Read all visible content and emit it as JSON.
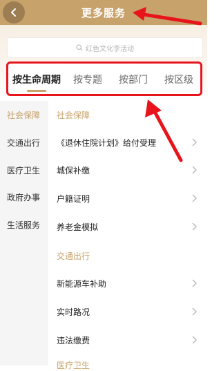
{
  "header": {
    "title": "更多服务"
  },
  "search": {
    "placeholder": "红色文化李活动"
  },
  "tabs": [
    {
      "label": "按生命周期"
    },
    {
      "label": "按专题"
    },
    {
      "label": "按部门"
    },
    {
      "label": "按区级"
    }
  ],
  "sidebar": {
    "items": [
      {
        "label": "社会保障"
      },
      {
        "label": "交通出行"
      },
      {
        "label": "医疗卫生"
      },
      {
        "label": "政府办事"
      },
      {
        "label": "生活服务"
      }
    ]
  },
  "content": {
    "sections": [
      {
        "title": "社会保障",
        "items": [
          "《退休住院计划》给付受理",
          "城保补缴",
          "户籍证明",
          "养老金模拟"
        ]
      },
      {
        "title": "交通出行",
        "items": [
          "新能源车补助",
          "实时路况",
          "违法缴费"
        ]
      },
      {
        "title": "医疗卫生",
        "items": []
      }
    ]
  },
  "colors": {
    "accent": "#c7a26a",
    "highlight": "#e8141c"
  }
}
